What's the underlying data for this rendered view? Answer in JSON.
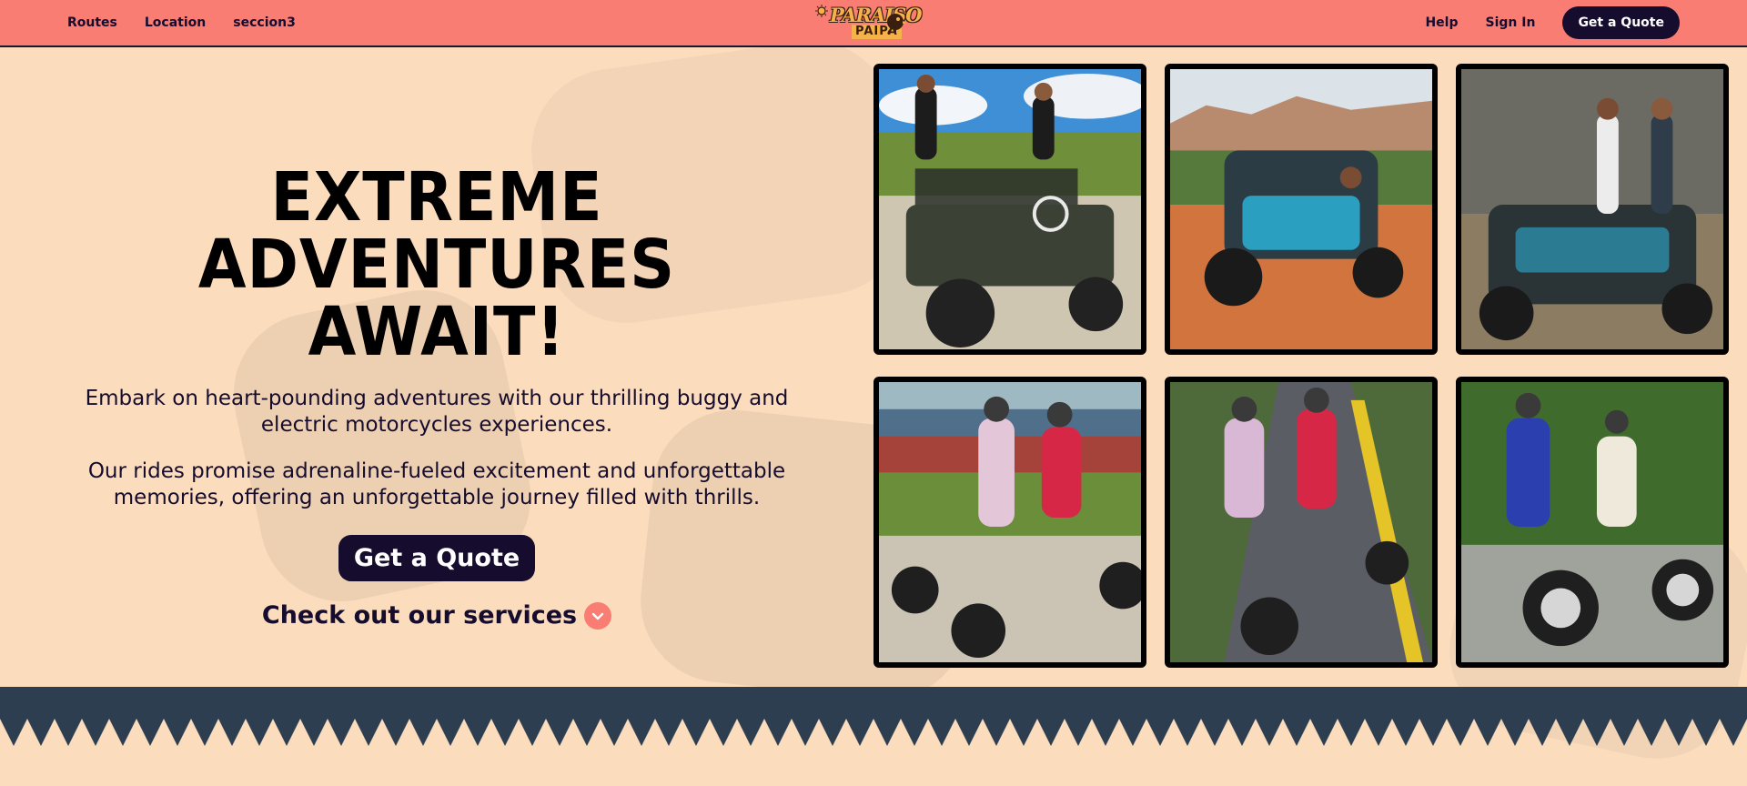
{
  "nav": {
    "links": [
      {
        "label": "Routes"
      },
      {
        "label": "Location"
      },
      {
        "label": "seccion3"
      }
    ],
    "right": {
      "help": "Help",
      "sign_in": "Sign In",
      "cta": "Get a Quote"
    },
    "logo": {
      "top": "PARAISO",
      "bottom": "PAIPA"
    }
  },
  "hero": {
    "title_line1": "EXTREME",
    "title_line2": "ADVENTURES AWAIT!",
    "paragraph1": "Embark on heart-pounding adventures with our thrilling buggy and electric motorcycles experiences.",
    "paragraph2": "Our rides promise adrenaline-fueled excitement and unforgettable memories, offering an unforgettable journey filled with thrills.",
    "cta": "Get a Quote",
    "services_link": "Check out our services"
  },
  "gallery": {
    "photos": [
      {
        "icon": "jeep-photo"
      },
      {
        "icon": "buggy-canyon-photo"
      },
      {
        "icon": "buggy-desert-photo"
      },
      {
        "icon": "scooter-lake-photo"
      },
      {
        "icon": "scooter-road-photo"
      },
      {
        "icon": "scooter-park-photo"
      }
    ]
  },
  "colors": {
    "background": "#fbdcbd",
    "nav": "#fa7d74",
    "dark": "#150c2e",
    "band": "#2e3e51",
    "accent": "#fa7d74"
  }
}
